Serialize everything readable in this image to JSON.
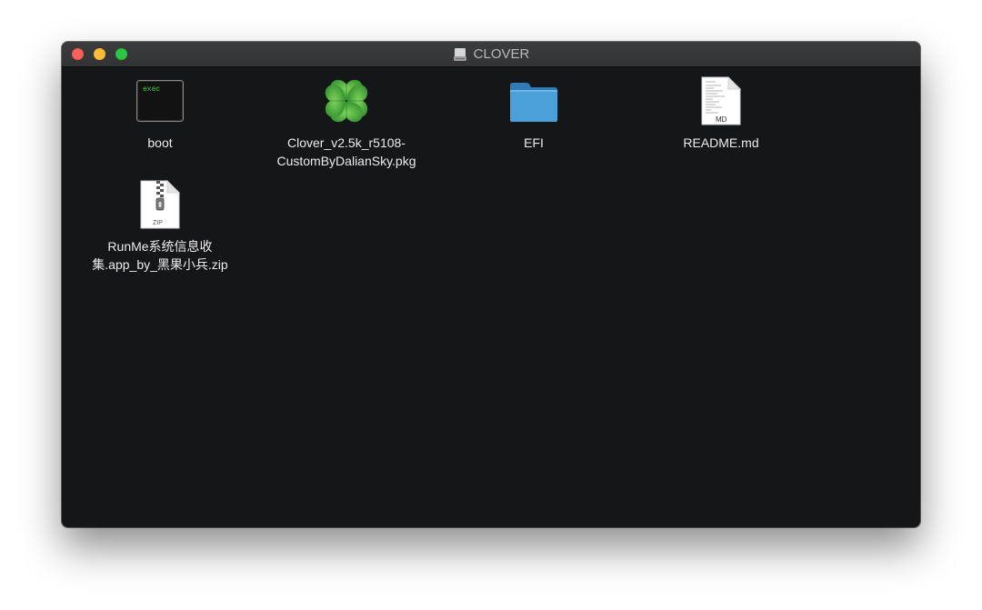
{
  "window": {
    "title": "CLOVER",
    "title_icon": "external-drive-icon",
    "traffic_lights": {
      "close": "#fe5f57",
      "minimize": "#febc2e",
      "zoom": "#28c840"
    }
  },
  "files": [
    {
      "name_line1": "boot",
      "name_line2": "",
      "icon": "exec-terminal-icon",
      "icon_text": "exec"
    },
    {
      "name_line1": "Clover_v2.5k_r5108-",
      "name_line2": "CustomByDalianSky.pkg",
      "icon": "clover-package-icon"
    },
    {
      "name_line1": "EFI",
      "name_line2": "",
      "icon": "folder-icon"
    },
    {
      "name_line1": "README.md",
      "name_line2": "",
      "icon": "markdown-document-icon",
      "icon_text": "MD"
    },
    {
      "name_line1": "RunMe系统信息收",
      "name_line2": "集.app_by_黑果小兵.zip",
      "icon": "zip-archive-icon",
      "icon_text": "ZIP"
    }
  ]
}
